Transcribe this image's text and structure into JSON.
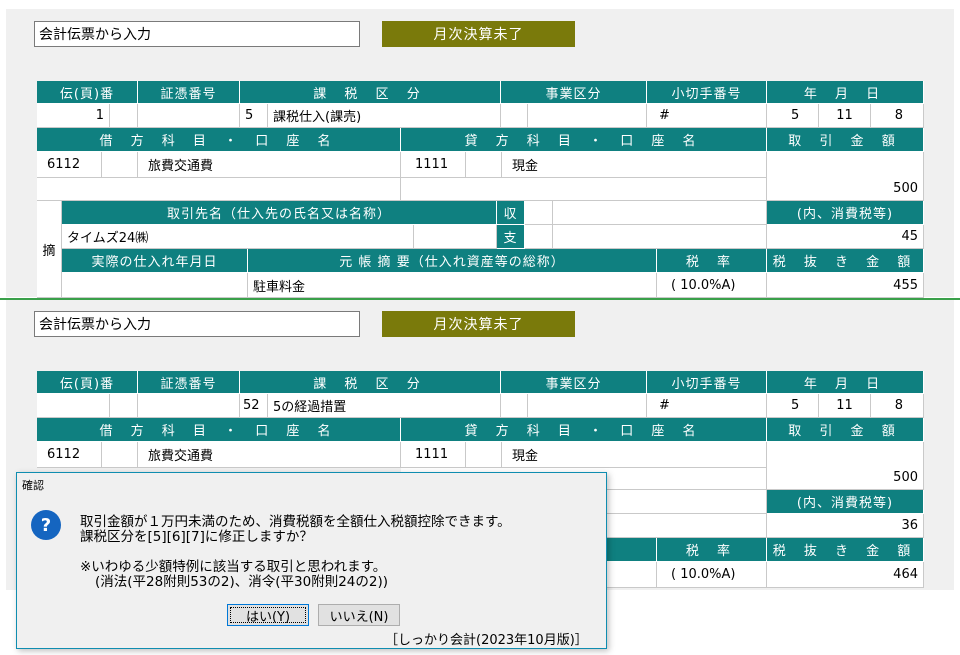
{
  "top": {
    "title_input": "会計伝票から入力",
    "status_button": "月次決算未了",
    "headers": {
      "denpyo_no": "伝(頁)番",
      "shohyo_no": "証憑番号",
      "zei_kubun": "課 税 区 分",
      "jigyo_kubun": "事業区分",
      "kogitte_no": "小切手番号",
      "date": "年 月 日",
      "debit_account": "借 方 科 目 ・ 口 座 名",
      "credit_account": "貸 方 科 目 ・ 口 座 名",
      "amount": "取 引 金 額",
      "partner": "取引先名（仕入先の氏名又は名称）",
      "receive": "収",
      "pay": "支",
      "tax_included": "(内、消費税等)",
      "summary": "摘",
      "purchase_date": "実際の仕入れ年月日",
      "ledger_summary": "元 帳 摘 要（仕入れ資産等の総称）",
      "tax_rate": "税 率",
      "amount_excl_tax": "税 抜 き 金 額"
    },
    "values": {
      "denpyo_no": "1",
      "zei_code": "5",
      "zei_name": "課税仕入(課売)",
      "kogitte_no": "#",
      "year": "5",
      "month": "11",
      "day": "8",
      "debit_code": "6112",
      "debit_name": "旅費交通費",
      "credit_code": "1111",
      "credit_name": "現金",
      "amount": "500",
      "partner_name": "タイムズ24㈱",
      "tax_amount": "45",
      "ledger_summary": "駐車料金",
      "tax_rate": "(  10.0%A)",
      "amount_excl_tax": "455"
    }
  },
  "bottom": {
    "title_input": "会計伝票から入力",
    "status_button": "月次決算未了",
    "values": {
      "zei_code": "52",
      "zei_name": "5の経過措置",
      "kogitte_no": "#",
      "year": "5",
      "month": "11",
      "day": "8",
      "debit_code": "6112",
      "debit_name": "旅費交通費",
      "credit_code": "1111",
      "credit_name": "現金",
      "amount": "500",
      "tax_amount": "36",
      "tax_rate": "(  10.0%A)",
      "amount_excl_tax": "464"
    }
  },
  "dialog": {
    "title": "確認",
    "line1": "取引金額が１万円未満のため、消費税額を全額仕入税額控除できます。",
    "line2": "課税区分を[5][6][7]に修正しますか？",
    "line3": "※いわゆる少額特例に該当する取引と思われます。",
    "line4": "(消法(平28附則53の2)、消令(平30附則24の2))",
    "yes_button": "はい(Y)",
    "no_button": "いいえ(N)",
    "footer": "［しっかり会計(2023年10月版)］"
  },
  "colors": {
    "header_teal": "#0f8080",
    "status_olive": "#7a7a0b",
    "panel": "#f0f0f0",
    "question_icon": "#1565c0"
  }
}
